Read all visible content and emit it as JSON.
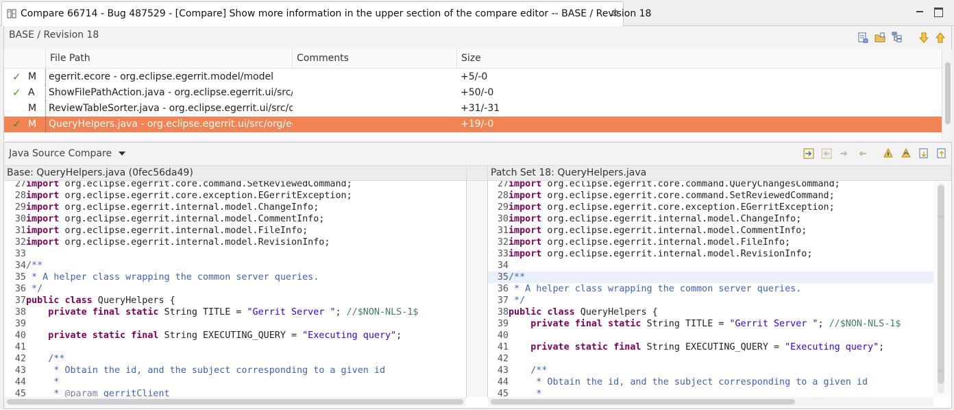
{
  "window": {
    "tab_title": "Compare 66714 - Bug 487529 - [Compare] Show more information in the upper section of the compare editor -- BASE / Revision 18",
    "close_glyph": "⊠",
    "editor_icon": "compare-editor-icon"
  },
  "structure": {
    "title": "BASE / Revision 18",
    "columns": [
      "File Path",
      "Comments",
      "Size"
    ],
    "rows": [
      {
        "reviewed": "✓",
        "status": "M",
        "path": "egerrit.ecore - org.eclipse.egerrit.model/model",
        "comments": "",
        "size": "+5/-0",
        "selected": false
      },
      {
        "reviewed": "✓",
        "status": "A",
        "path": "ShowFilePathAction.java - org.eclipse.egerrit.ui/src/o",
        "comments": "",
        "size": "+50/-0",
        "selected": false
      },
      {
        "reviewed": "",
        "status": "M",
        "path": "ReviewTableSorter.java - org.eclipse.egerrit.ui/src/or",
        "comments": "",
        "size": "+31/-31",
        "selected": false
      },
      {
        "reviewed": "✓",
        "status": "M",
        "path": "QueryHelpers.java - org.eclipse.egerrit.ui/src/org/ecl",
        "comments": "",
        "size": "+19/-0",
        "selected": true
      }
    ],
    "toolbar_icons": [
      "show-file-icon",
      "open-folder-icon",
      "tree-layout-icon",
      "next-difference-icon",
      "previous-difference-icon"
    ]
  },
  "compare": {
    "viewer_label": "Java Source Compare",
    "toolbar_icons": [
      "copy-all-left-to-right-icon",
      "copy-all-right-to-left-icon",
      "copy-current-left-to-right-icon",
      "copy-current-right-to-left-icon",
      "next-change-icon",
      "previous-change-icon",
      "next-diff-icon",
      "previous-diff-icon"
    ],
    "left_title": "Base: QueryHelpers.java (0fec56da49)",
    "right_title": "Patch Set 18: QueryHelpers.java",
    "left_lines": [
      {
        "n": "27",
        "t": "import org.eclipse.egerrit.core.command.SetReviewedCommand;"
      },
      {
        "n": "28",
        "t": "import org.eclipse.egerrit.core.exception.EGerritException;"
      },
      {
        "n": "29",
        "t": "import org.eclipse.egerrit.internal.model.ChangeInfo;"
      },
      {
        "n": "30",
        "t": "import org.eclipse.egerrit.internal.model.CommentInfo;"
      },
      {
        "n": "31",
        "t": "import org.eclipse.egerrit.internal.model.FileInfo;"
      },
      {
        "n": "32",
        "t": "import org.eclipse.egerrit.internal.model.RevisionInfo;"
      },
      {
        "n": "33",
        "t": ""
      },
      {
        "n": "34",
        "t": "/**"
      },
      {
        "n": "35",
        "t": " * A helper class wrapping the common server queries."
      },
      {
        "n": "36",
        "t": " */"
      },
      {
        "n": "37",
        "t": "public class QueryHelpers {"
      },
      {
        "n": "38",
        "t": "    private final static String TITLE = \"Gerrit Server \"; //$NON-NLS-1$"
      },
      {
        "n": "39",
        "t": ""
      },
      {
        "n": "40",
        "t": "    private static final String EXECUTING_QUERY = \"Executing query\";"
      },
      {
        "n": "41",
        "t": ""
      },
      {
        "n": "42",
        "t": "    /**"
      },
      {
        "n": "43",
        "t": "     * Obtain the id, and the subject corresponding to a given id"
      },
      {
        "n": "44",
        "t": "     *"
      },
      {
        "n": "45",
        "t": "     * @param gerritClient"
      }
    ],
    "right_lines": [
      {
        "n": "27",
        "t": "import org.eclipse.egerrit.core.command.QueryChangesCommand;"
      },
      {
        "n": "28",
        "t": "import org.eclipse.egerrit.core.command.SetReviewedCommand;"
      },
      {
        "n": "29",
        "t": "import org.eclipse.egerrit.core.exception.EGerritException;"
      },
      {
        "n": "30",
        "t": "import org.eclipse.egerrit.internal.model.ChangeInfo;"
      },
      {
        "n": "31",
        "t": "import org.eclipse.egerrit.internal.model.CommentInfo;"
      },
      {
        "n": "32",
        "t": "import org.eclipse.egerrit.internal.model.FileInfo;"
      },
      {
        "n": "33",
        "t": "import org.eclipse.egerrit.internal.model.RevisionInfo;"
      },
      {
        "n": "34",
        "t": ""
      },
      {
        "n": "35",
        "t": "/**"
      },
      {
        "n": "36",
        "t": " * A helper class wrapping the common server queries."
      },
      {
        "n": "37",
        "t": " */"
      },
      {
        "n": "38",
        "t": "public class QueryHelpers {"
      },
      {
        "n": "39",
        "t": "    private final static String TITLE = \"Gerrit Server \"; //$NON-NLS-1$"
      },
      {
        "n": "40",
        "t": ""
      },
      {
        "n": "41",
        "t": "    private static final String EXECUTING_QUERY = \"Executing query\";"
      },
      {
        "n": "42",
        "t": ""
      },
      {
        "n": "43",
        "t": "    /**"
      },
      {
        "n": "44",
        "t": "     * Obtain the id, and the subject corresponding to a given id"
      },
      {
        "n": "45",
        "t": "     *"
      }
    ]
  },
  "colors": {
    "selection": "#f28454",
    "keyword": "#7f0055",
    "string": "#2a00ff",
    "javadoc": "#3f5fbf",
    "line_comment": "#3f7f5f"
  }
}
